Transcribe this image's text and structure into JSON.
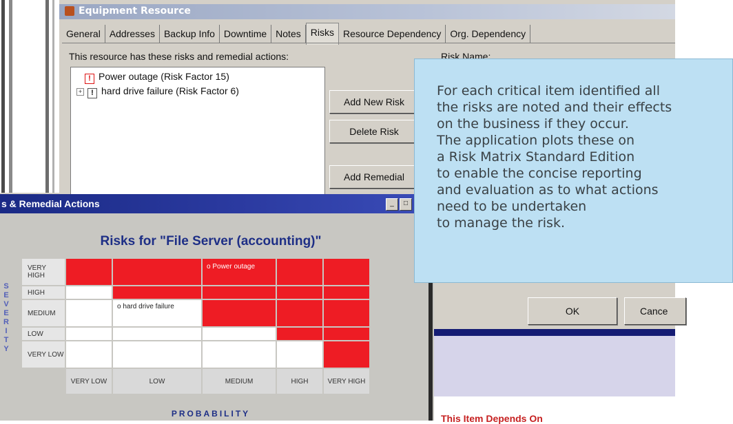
{
  "equipment_window": {
    "title": "Equipment Resource",
    "tabs": [
      "General",
      "Addresses",
      "Backup Info",
      "Downtime",
      "Notes",
      "Risks",
      "Resource Dependency",
      "Org. Dependency"
    ],
    "active_tab": "Risks",
    "list_label": "This resource has these risks and remedial actions:",
    "risk_name_label": "Risk Name:",
    "risks": [
      {
        "label": "Power outage (Risk Factor 15)",
        "flag": "!"
      },
      {
        "label": "hard drive failure (Risk Factor 6)",
        "flag": "!",
        "expander": "+"
      }
    ],
    "buttons": {
      "add_risk": "Add New Risk",
      "delete_risk": "Delete Risk",
      "add_remedial": "Add Remedial"
    },
    "ok": "OK",
    "cancel": "Cance",
    "depends_on": "This Item Depends On"
  },
  "matrix_window": {
    "title": "s & Remedial Actions",
    "min_icon": "_",
    "max_icon": "□",
    "heading": "Risks for \"File Server (accounting)\"",
    "severity_letters": [
      "S",
      "E",
      "V",
      "E",
      "R",
      "I",
      "T",
      "Y"
    ],
    "probability_label": "PROBABILITY",
    "row_labels": [
      "VERY HIGH",
      "HIGH",
      "MEDIUM",
      "LOW",
      "VERY LOW"
    ],
    "col_labels": [
      "VERY LOW",
      "LOW",
      "MEDIUM",
      "HIGH",
      "VERY HIGH"
    ],
    "cell_labels": {
      "power_outage": "o Power outage",
      "hard_drive": "o hard drive failure"
    },
    "colors": {
      "red": "#ee1c24",
      "white": "#ffffff",
      "heading": "#1e2f86"
    }
  },
  "callout": {
    "text": "For each critical item identified all\nthe risks are noted and their effects\non the business if they occur.\nThe application plots these on\na Risk Matrix Standard Edition\nto enable the concise reporting\nand evaluation as to what actions\nneed to be undertaken\nto manage the risk."
  }
}
